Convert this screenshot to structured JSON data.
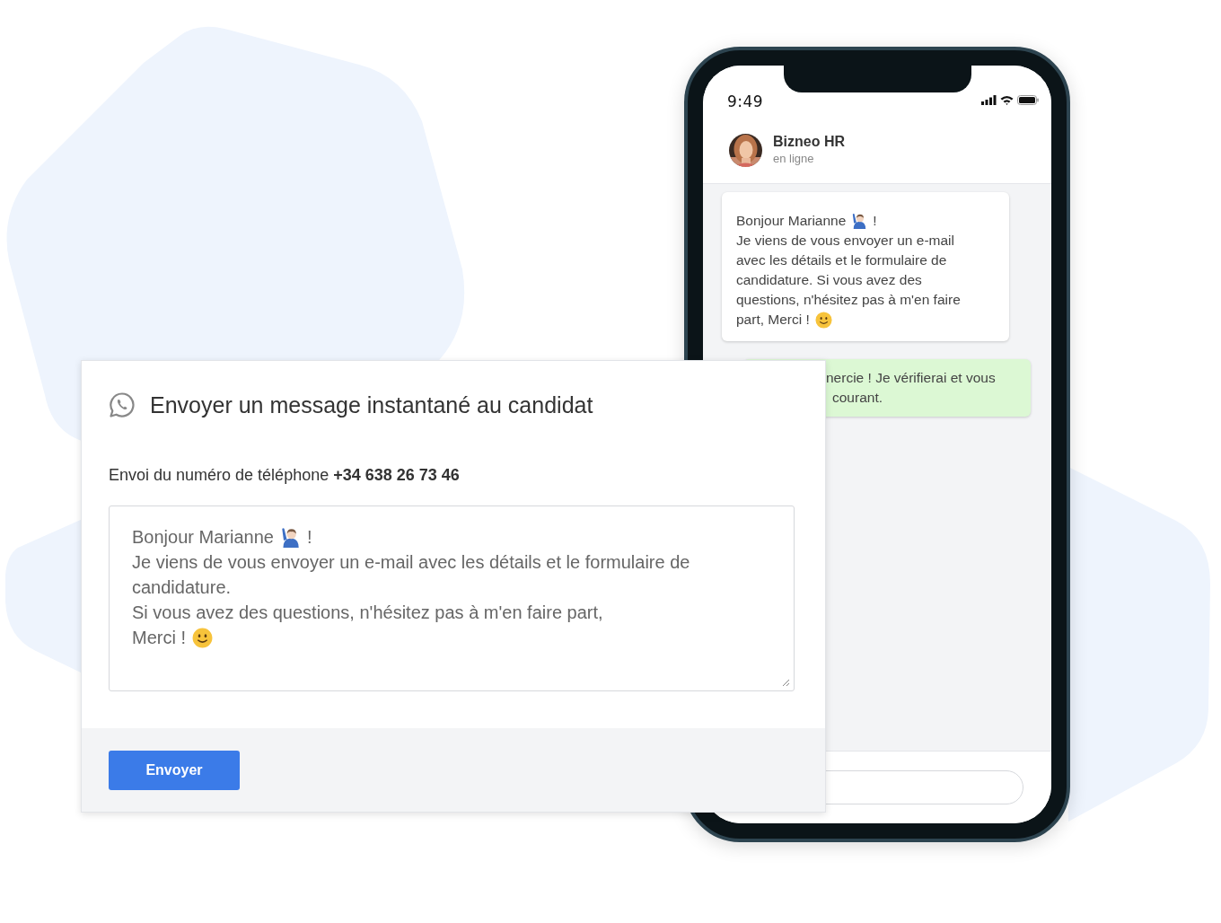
{
  "phone": {
    "status_time": "9:49",
    "contact": {
      "name": "Bizneo HR",
      "status": "en ligne"
    },
    "received": {
      "lines": [
        [
          {
            "kind": "text",
            "text": "Bonjour Marianne"
          },
          {
            "kind": "person-emoji"
          },
          {
            "kind": "text",
            "text": "!"
          }
        ],
        [
          {
            "kind": "text",
            "text": "Je viens de vous envoyer un e-mail"
          }
        ],
        [
          {
            "kind": "text",
            "text": "avec les détails et le formulaire de"
          }
        ],
        [
          {
            "kind": "text",
            "text": "candidature. Si vous avez des"
          }
        ],
        [
          {
            "kind": "text",
            "text": "questions, n'hésitez pas à m'en faire"
          }
        ],
        [
          {
            "kind": "text",
            "text": "part, Merci !"
          },
          {
            "kind": "smile-emoji"
          }
        ]
      ]
    },
    "sent": {
      "lines": [
        "nercie ! Je vérifierai et vous",
        "courant."
      ]
    }
  },
  "dialog": {
    "title": "Envoyer un message instantané au candidat",
    "phone_line": "Envoi du numéro de téléphone **+34 638 26 73 46**",
    "message": {
      "lines": [
        [
          {
            "kind": "text",
            "text": "Bonjour Marianne"
          },
          {
            "kind": "person-emoji"
          },
          {
            "kind": "text",
            "text": "!"
          }
        ],
        [
          {
            "kind": "text",
            "text": "Je viens de vous envoyer un e-mail avec les détails et le formulaire de"
          }
        ],
        [
          {
            "kind": "text",
            "text": "candidature."
          }
        ],
        [
          {
            "kind": "text",
            "text": "Si vous avez des questions, n'hésitez pas à m'en faire part,"
          }
        ],
        [
          {
            "kind": "text",
            "text": "Merci !"
          },
          {
            "kind": "smile-emoji"
          }
        ]
      ]
    },
    "button": "Envoyer"
  }
}
